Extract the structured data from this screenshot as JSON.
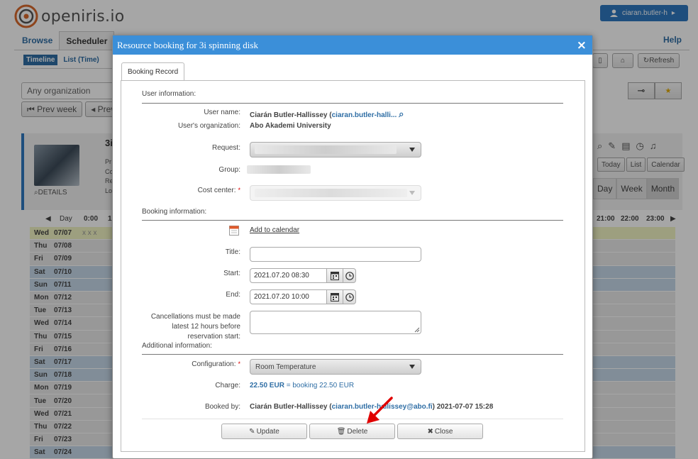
{
  "app": {
    "logo_text": "openiris.io",
    "user_button": "ciaran.butler-h"
  },
  "nav": {
    "tabs": [
      "Browse",
      "Scheduler"
    ],
    "help": "Help",
    "subtabs": [
      "Timeline",
      "List (Time)"
    ],
    "refresh": "Refresh"
  },
  "filters": {
    "organization": "Any organization",
    "prev_week": "Prev week",
    "prev": "Prev"
  },
  "resource": {
    "title": "3i",
    "details": "DETAILS",
    "meta_lines": [
      "Pr",
      "Co",
      "Re",
      "Lo"
    ],
    "view_buttons": [
      "Today",
      "List",
      "Calendar"
    ],
    "range_buttons": [
      "Day",
      "Week",
      "Month"
    ]
  },
  "timeline": {
    "header_left": "Day",
    "hours_left": [
      "0:00",
      "1"
    ],
    "hours_right": [
      "21:00",
      "22:00",
      "23:00"
    ],
    "today_marks": "x x x",
    "days": [
      {
        "name": "Wed",
        "date": "07/07",
        "kind": "today"
      },
      {
        "name": "Thu",
        "date": "07/08",
        "kind": "weekday"
      },
      {
        "name": "Fri",
        "date": "07/09",
        "kind": "weekday"
      },
      {
        "name": "Sat",
        "date": "07/10",
        "kind": "weekend"
      },
      {
        "name": "Sun",
        "date": "07/11",
        "kind": "weekend"
      },
      {
        "name": "Mon",
        "date": "07/12",
        "kind": "weekday"
      },
      {
        "name": "Tue",
        "date": "07/13",
        "kind": "weekday"
      },
      {
        "name": "Wed",
        "date": "07/14",
        "kind": "weekday"
      },
      {
        "name": "Thu",
        "date": "07/15",
        "kind": "weekday"
      },
      {
        "name": "Fri",
        "date": "07/16",
        "kind": "weekday"
      },
      {
        "name": "Sat",
        "date": "07/17",
        "kind": "weekend"
      },
      {
        "name": "Sun",
        "date": "07/18",
        "kind": "weekend"
      },
      {
        "name": "Mon",
        "date": "07/19",
        "kind": "weekday"
      },
      {
        "name": "Tue",
        "date": "07/20",
        "kind": "weekday"
      },
      {
        "name": "Wed",
        "date": "07/21",
        "kind": "weekday"
      },
      {
        "name": "Thu",
        "date": "07/22",
        "kind": "weekday"
      },
      {
        "name": "Fri",
        "date": "07/23",
        "kind": "weekday"
      },
      {
        "name": "Sat",
        "date": "07/24",
        "kind": "weekend"
      }
    ]
  },
  "modal": {
    "title": "Resource booking for 3i spinning disk",
    "close_glyph": "×",
    "tab": "Booking Record",
    "user_info_title": "User information:",
    "user_name_label": "User name:",
    "user_name": "Ciarán Butler-Hallissey",
    "user_name_link": "ciaran.butler-halli...",
    "org_label": "User's organization:",
    "org_value": "Abo Akademi University",
    "request_label": "Request:",
    "group_label": "Group:",
    "cost_center_label": "Cost center:",
    "booking_info_title": "Booking information:",
    "add_to_calendar": "Add to calendar",
    "title_label": "Title:",
    "title_value": "",
    "start_label": "Start:",
    "start_value": "2021.07.20 08:30",
    "end_label": "End:",
    "end_value": "2021.07.20 10:00",
    "cancellation_text": [
      "Cancellations must be made",
      "latest 12 hours before",
      "reservation start:"
    ],
    "additional_info_title": "Additional information:",
    "configuration_label": "Configuration:",
    "configuration_value": "Room Temperature",
    "charge_label": "Charge:",
    "charge_amount": "22.50 EUR",
    "charge_detail": "= booking 22.50 EUR",
    "booked_by_label": "Booked by:",
    "booked_by_name": "Ciarán Butler-Hallissey",
    "booked_by_email": "ciaran.butler-hallissey@abo.fi",
    "booked_by_time": "2021-07-07 15:28",
    "buttons": {
      "update": "Update",
      "delete": "Delete",
      "close": "Close"
    }
  },
  "colors": {
    "accent_blue": "#3b8fd9",
    "link_blue": "#2f6ea5",
    "annotation_red": "#e00000",
    "weekend_row": "#c6d9ea",
    "today_row": "#f2f4c4"
  }
}
